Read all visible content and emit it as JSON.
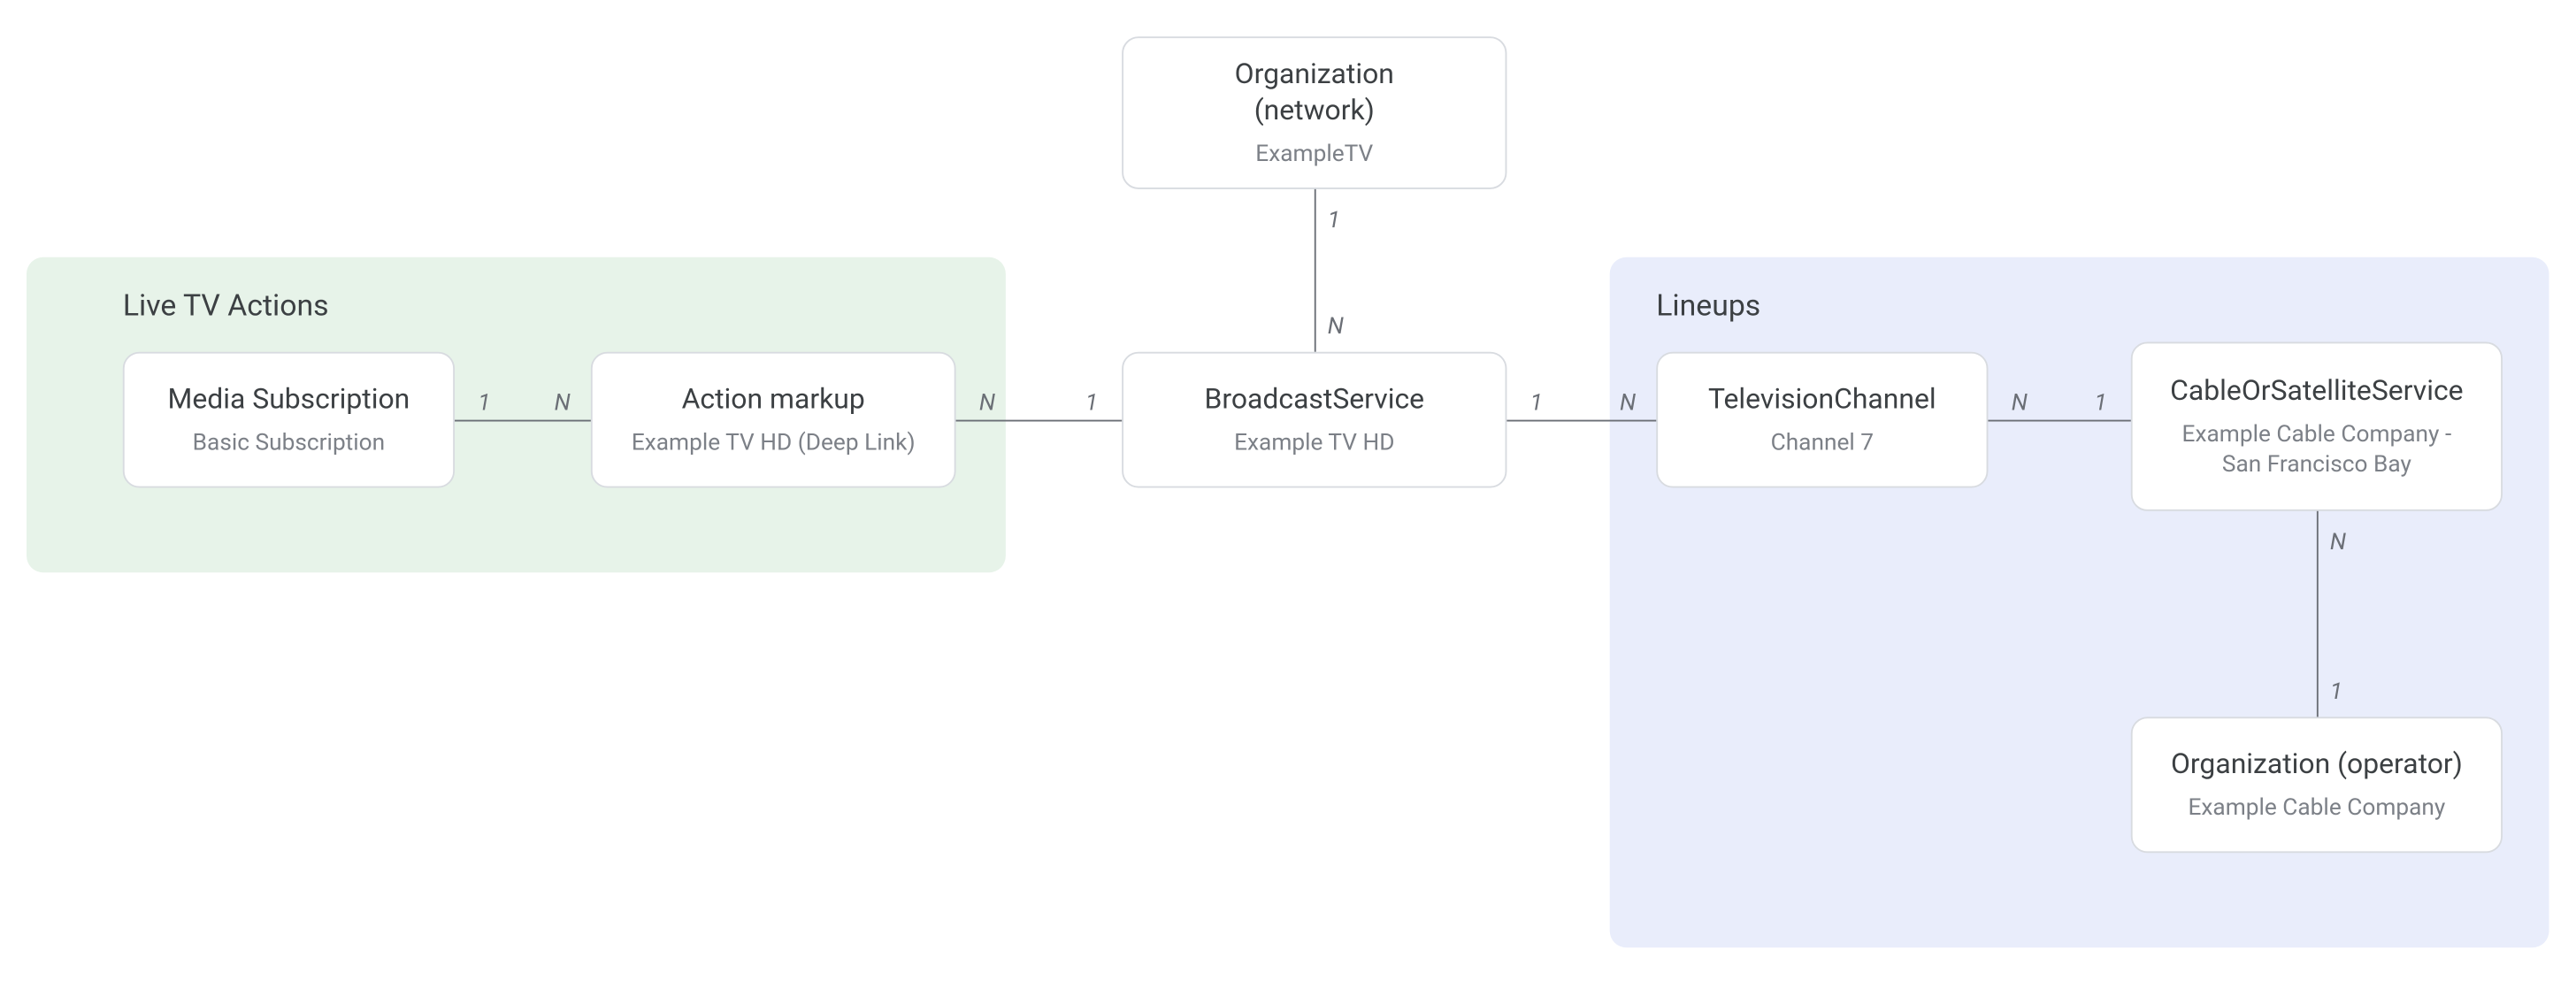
{
  "panels": {
    "left": {
      "title": "Live TV Actions"
    },
    "right": {
      "title": "Lineups"
    }
  },
  "nodes": {
    "org_network": {
      "title": "Organization\n(network)",
      "sub": "ExampleTV"
    },
    "media_sub": {
      "title": "Media Subscription",
      "sub": "Basic Subscription"
    },
    "action_markup": {
      "title": "Action markup",
      "sub": "Example TV HD (Deep Link)"
    },
    "broadcast": {
      "title": "BroadcastService",
      "sub": "Example TV HD"
    },
    "tv_channel": {
      "title": "TelevisionChannel",
      "sub": "Channel 7"
    },
    "cable_sat": {
      "title": "CableOrSatelliteService",
      "sub": "Example Cable Company -\nSan Francisco Bay"
    },
    "org_operator": {
      "title": "Organization (operator)",
      "sub": "Example Cable Company"
    }
  },
  "edges": {
    "org_broadcast": {
      "near_top": "1",
      "near_bottom": "N"
    },
    "media_action": {
      "near_left": "1",
      "near_right": "N"
    },
    "action_broadcast": {
      "near_left": "N",
      "near_right": "1"
    },
    "broadcast_tv": {
      "near_left": "1",
      "near_right": "N"
    },
    "tv_cable": {
      "near_left": "N",
      "near_right": "1"
    },
    "cable_operator": {
      "near_top": "N",
      "near_bottom": "1"
    }
  }
}
